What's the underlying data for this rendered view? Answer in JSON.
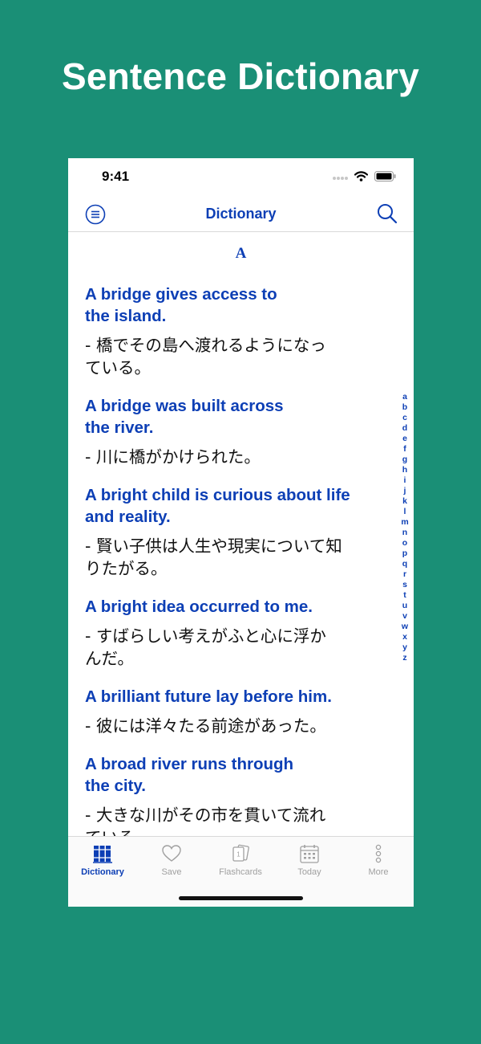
{
  "promo": {
    "title": "Sentence Dictionary"
  },
  "status_bar": {
    "time": "9:41"
  },
  "nav": {
    "title": "Dictionary"
  },
  "section": {
    "letter": "A"
  },
  "entries": [
    {
      "en": "A bridge gives access to\nthe island.",
      "ja": "- 橋でその島へ渡れるようになっ\nている。"
    },
    {
      "en": "A bridge was built across\nthe river.",
      "ja": "- 川に橋がかけられた。"
    },
    {
      "en": "A bright child is curious about life\nand reality.",
      "ja": "- 賢い子供は人生や現実について知\nりたがる。"
    },
    {
      "en": "A bright idea occurred to me.",
      "ja": "- すばらしい考えがふと心に浮か\nんだ。"
    },
    {
      "en": "A brilliant future lay before him.",
      "ja": "- 彼には洋々たる前途があった。"
    },
    {
      "en": "A broad river runs through\nthe city.",
      "ja": "- 大きな川がその市を貫いて流れ\nている。"
    }
  ],
  "index_letters": [
    "a",
    "b",
    "c",
    "d",
    "e",
    "f",
    "g",
    "h",
    "i",
    "j",
    "k",
    "l",
    "m",
    "n",
    "o",
    "p",
    "q",
    "r",
    "s",
    "t",
    "u",
    "v",
    "w",
    "x",
    "y",
    "z"
  ],
  "tabs": [
    {
      "label": "Dictionary",
      "icon": "books-icon",
      "active": true
    },
    {
      "label": "Save",
      "icon": "heart-icon",
      "active": false
    },
    {
      "label": "Flashcards",
      "icon": "flashcards-icon",
      "active": false
    },
    {
      "label": "Today",
      "icon": "calendar-icon",
      "active": false
    },
    {
      "label": "More",
      "icon": "more-dots-icon",
      "active": false
    }
  ],
  "colors": {
    "brand_background": "#1a8f76",
    "accent": "#0d3fb5",
    "inactive": "#a0a0a0"
  }
}
